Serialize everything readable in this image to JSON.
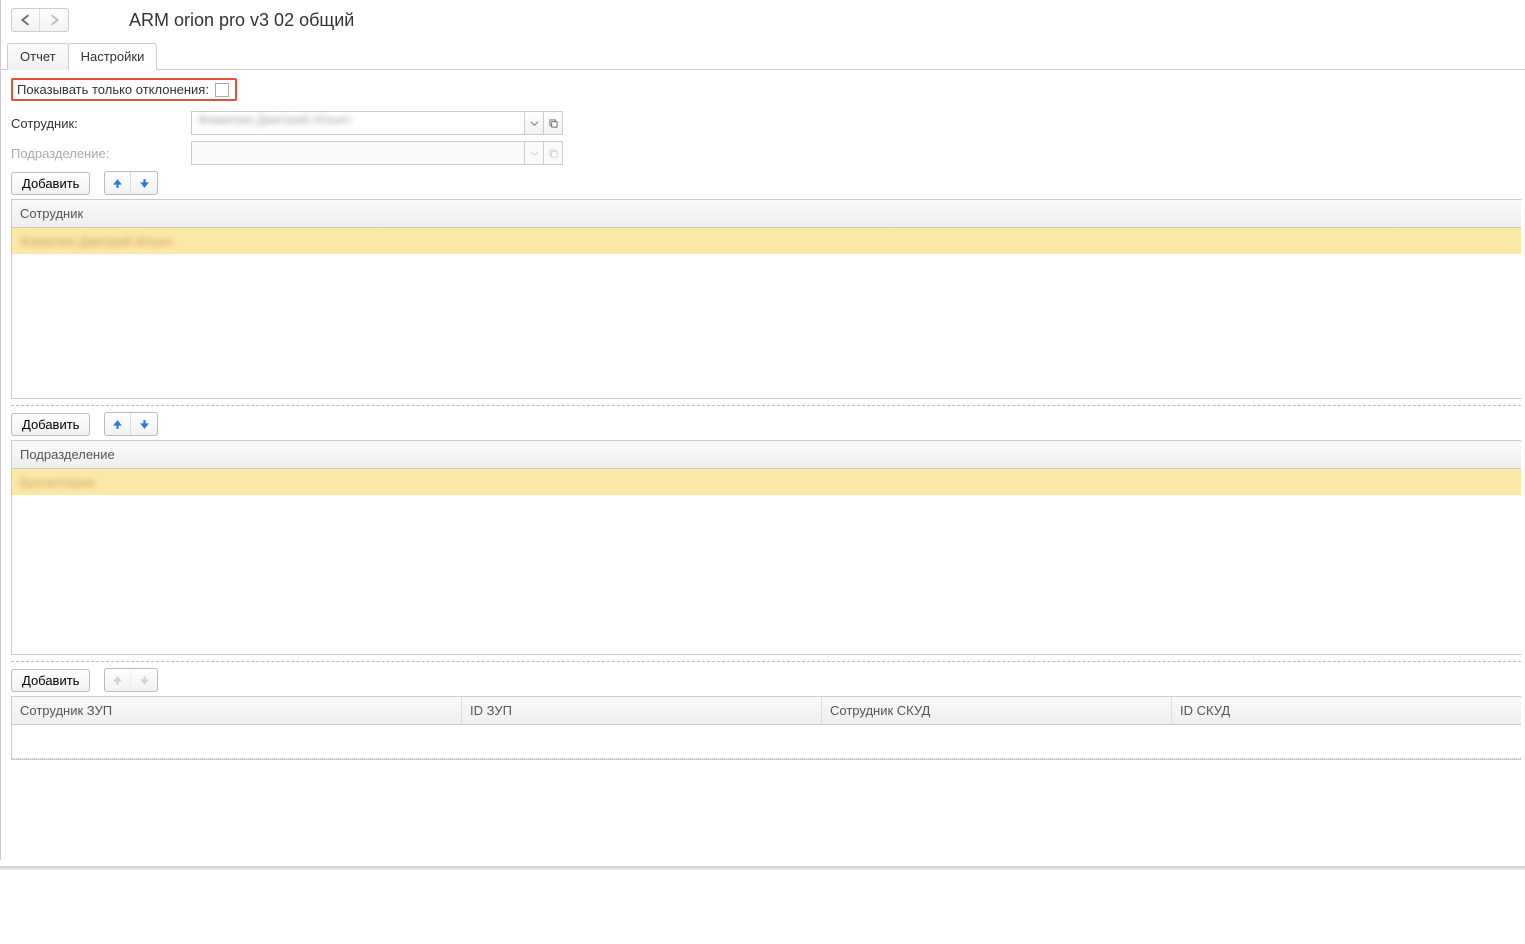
{
  "title": "АRМ orion pro v3 02 общий",
  "tabs": {
    "report": "Отчет",
    "settings": "Настройки"
  },
  "checkbox": {
    "label": "Показывать только отклонения:"
  },
  "fields": {
    "employee_label": "Сотрудник:",
    "employee_value": "Фамилия Дмитрий Ильич",
    "department_label": "Подразделение:",
    "department_value": ""
  },
  "buttons": {
    "add": "Добавить"
  },
  "grid1": {
    "header": "Сотрудник",
    "row": "Фамилия Дмитрий Ильич"
  },
  "grid2": {
    "header": "Подразделение",
    "row": "Бухгалтерия"
  },
  "grid3": {
    "col1": "Сотрудник ЗУП",
    "col2": "ID ЗУП",
    "col3": "Сотрудник СКУД",
    "col4": "ID СКУД"
  }
}
